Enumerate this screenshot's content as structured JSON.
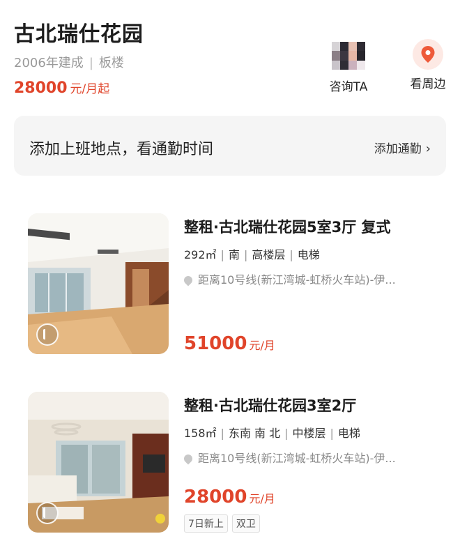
{
  "community": {
    "name": "古北瑞仕花园",
    "year_built": "2006年建成",
    "building_type": "板楼",
    "meta_separator": "|",
    "price_value": "28000",
    "price_unit": "元/月起"
  },
  "actions": {
    "consult_label": "咨询TA",
    "nearby_label": "看周边"
  },
  "commute": {
    "prompt": "添加上班地点，看通勤时间",
    "link_label": "添加通勤"
  },
  "listings": [
    {
      "title": "整租·古北瑞仕花园5室3厅 复式",
      "area": "292㎡",
      "orientation": "南",
      "floor": "高楼层",
      "elevator": "电梯",
      "location": "距离10号线(新江湾城-虹桥火车站)-伊...",
      "price_value": "51000",
      "price_unit": "元/月",
      "tags": []
    },
    {
      "title": "整租·古北瑞仕花园3室2厅",
      "area": "158㎡",
      "orientation": "东南 南 北",
      "floor": "中楼层",
      "elevator": "电梯",
      "location": "距离10号线(新江湾城-虹桥火车站)-伊...",
      "price_value": "28000",
      "price_unit": "元/月",
      "tags": [
        "7日新上",
        "双卫"
      ]
    }
  ],
  "colors": {
    "accent_red": "#e0442a",
    "text_primary": "#1c1c1c",
    "text_secondary": "#9a9a9a",
    "card_bg": "#f5f5f5"
  },
  "icons": {
    "avatar": "pixelated-avatar-icon",
    "nearby": "map-pin-icon",
    "chevron": "chevron-right-icon",
    "location": "location-pin-icon",
    "vr": "vr-tour-icon"
  }
}
